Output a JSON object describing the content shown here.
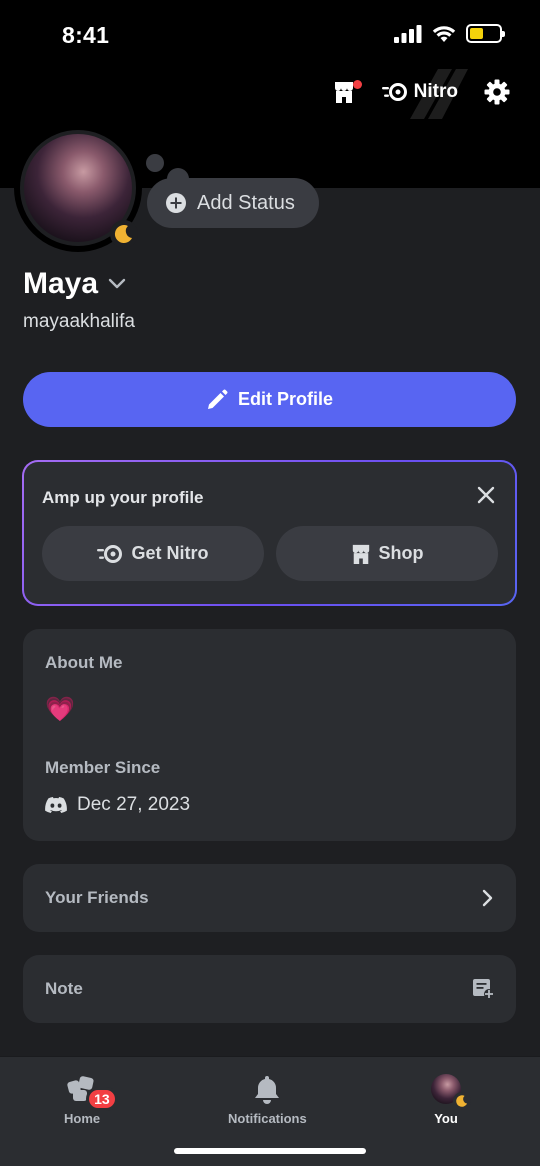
{
  "status_bar": {
    "time": "8:41"
  },
  "header": {
    "nitro_label": "Nitro"
  },
  "profile": {
    "display_name": "Maya",
    "username": "mayaakhalifa",
    "add_status_label": "Add Status"
  },
  "edit_profile_label": "Edit Profile",
  "promo": {
    "title": "Amp up your profile",
    "get_nitro_label": "Get Nitro",
    "shop_label": "Shop"
  },
  "about": {
    "about_label": "About Me",
    "about_text": "💗",
    "member_since_label": "Member Since",
    "member_since_date": "Dec 27, 2023"
  },
  "friends_label": "Your Friends",
  "note_label": "Note",
  "tabbar": {
    "home_label": "Home",
    "home_badge": "13",
    "notifications_label": "Notifications",
    "you_label": "You"
  },
  "colors": {
    "accent": "#5865f2",
    "badge": "#f23f43",
    "idle_moon": "#f0b232",
    "battery": "#f4d20b"
  }
}
